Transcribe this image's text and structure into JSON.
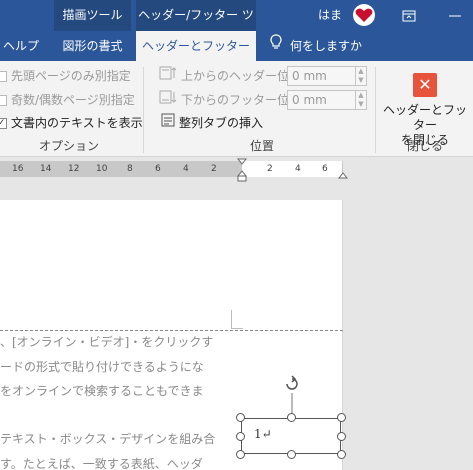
{
  "titlebar": {
    "context_draw": "描画ツール",
    "context_headerfooter": "ヘッダー/フッター ツール",
    "user_name": "はま",
    "avatar_icon": "heart-avatar-icon"
  },
  "tabs": {
    "help": "ヘルプ",
    "shape_format": "図形の書式",
    "header_footer": "ヘッダーとフッター",
    "tell_me": "何をしますか"
  },
  "options": {
    "different_first_page": "先頭ページのみ別指定",
    "different_odd_even": "奇数/偶数ページ別指定",
    "show_document_text": "文書内のテキストを表示",
    "group_label": "オプション"
  },
  "position": {
    "header_from_top_label": "上からのヘッダー位置:",
    "header_from_top_value": "0 mm",
    "footer_from_bottom_label": "下からのフッター位置:",
    "footer_from_bottom_value": "0 mm",
    "insert_alignment_tab": "整列タブの挿入",
    "group_label": "位置"
  },
  "close": {
    "button_label_line1": "ヘッダーとフッター",
    "button_label_line2": "を閉じる",
    "group_label": "閉じる"
  },
  "ruler": {
    "left_numbers": [
      "16",
      "14",
      "12",
      "10",
      "8",
      "6",
      "4",
      "2"
    ],
    "right_numbers": [
      "2",
      "4",
      "6"
    ]
  },
  "document": {
    "lines": [
      "、[オンライン・ビデオ]・をクリックす",
      "ードの形式で貼り付けできるようにな",
      "をオンラインで検索することもできま",
      "テキスト・ボックス・デザインを組み合",
      "す。たとえば、一致する表紙、ヘッダ"
    ],
    "textbox_content": "1↵"
  },
  "colors": {
    "ribbon_blue": "#2b579a",
    "close_red": "#e8533c"
  }
}
